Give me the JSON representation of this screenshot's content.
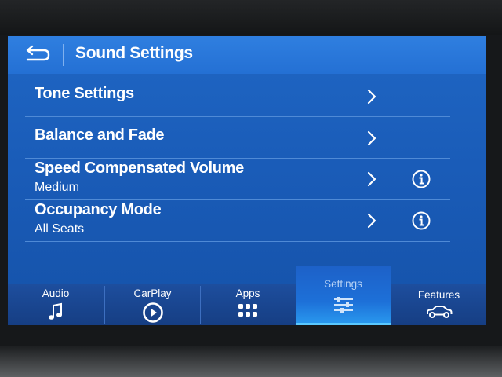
{
  "header": {
    "title": "Sound Settings",
    "back_icon": "back-arrow-icon"
  },
  "rows": [
    {
      "label": "Tone Settings",
      "icon": "chevron-right-icon"
    },
    {
      "label": "Balance and Fade",
      "icon": "chevron-right-icon"
    },
    {
      "label": "Speed Compensated Volume",
      "value": "Medium",
      "icon": "chevron-right-icon",
      "info_icon": "info-icon"
    },
    {
      "label": "Occupancy Mode",
      "value": "All Seats",
      "icon": "chevron-right-icon",
      "info_icon": "info-icon"
    }
  ],
  "nav": [
    {
      "label": "Audio",
      "icon": "music-note-icon"
    },
    {
      "label": "CarPlay",
      "icon": "carplay-icon"
    },
    {
      "label": "Apps",
      "icon": "apps-grid-icon"
    },
    {
      "label": "Settings",
      "icon": "settings-sliders-icon",
      "active": true
    },
    {
      "label": "Features",
      "icon": "car-icon"
    }
  ],
  "colors": {
    "screen_bg": "#1a5cb8",
    "header_bg": "#2a76da",
    "nav_bg": "#1a4690",
    "active_tab": "#2a9bf0",
    "active_label": "#b9d4f6"
  }
}
